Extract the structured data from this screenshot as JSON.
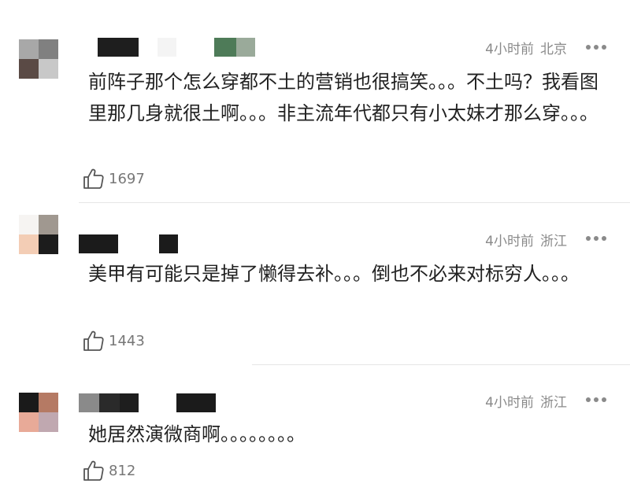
{
  "comments": [
    {
      "time": "4小时前",
      "location": "北京",
      "text": "前阵子那个怎么穿都不土的营销也很搞笑。。。不土吗？我看图里那几身就很土啊。。。非主流年代都只有小太妹才那么穿。。。",
      "likes": "1697",
      "avatar_colors": [
        "#a8a8a8",
        "#808080",
        "#5a4a45",
        "#c8c8c8"
      ],
      "username_blocks": [
        "#1e1e1e",
        "#f4f4f4",
        "#4e7b58",
        "#9aaa9a"
      ]
    },
    {
      "time": "4小时前",
      "location": "浙江",
      "text": "美甲有可能只是掉了懒得去补。。。倒也不必来对标穷人。。。",
      "likes": "1443",
      "avatar_colors": [
        "#f6f4f2",
        "#a09890",
        "#f3cdb5",
        "#1c1c1c"
      ],
      "username_blocks": [
        "#1b1b1b",
        "#ffffff",
        "#1b1b1b"
      ]
    },
    {
      "time": "4小时前",
      "location": "浙江",
      "text": "她居然演微商啊。。。。。。。。",
      "likes": "812",
      "avatar_colors": [
        "#1a1a1a",
        "#b57a64",
        "#e8aa98",
        "#c0a8b0"
      ],
      "username_blocks": [
        "#8a8a8a",
        "#2a2a2a",
        "#1e1e1e",
        "#ffffff",
        "#1b1b1b"
      ]
    }
  ],
  "icons": {
    "like": "thumbs-up-icon",
    "more": "more-dots-icon"
  },
  "colors": {
    "meta": "#8a8a8a",
    "text": "#222222",
    "divider": "#e6e6e6"
  }
}
